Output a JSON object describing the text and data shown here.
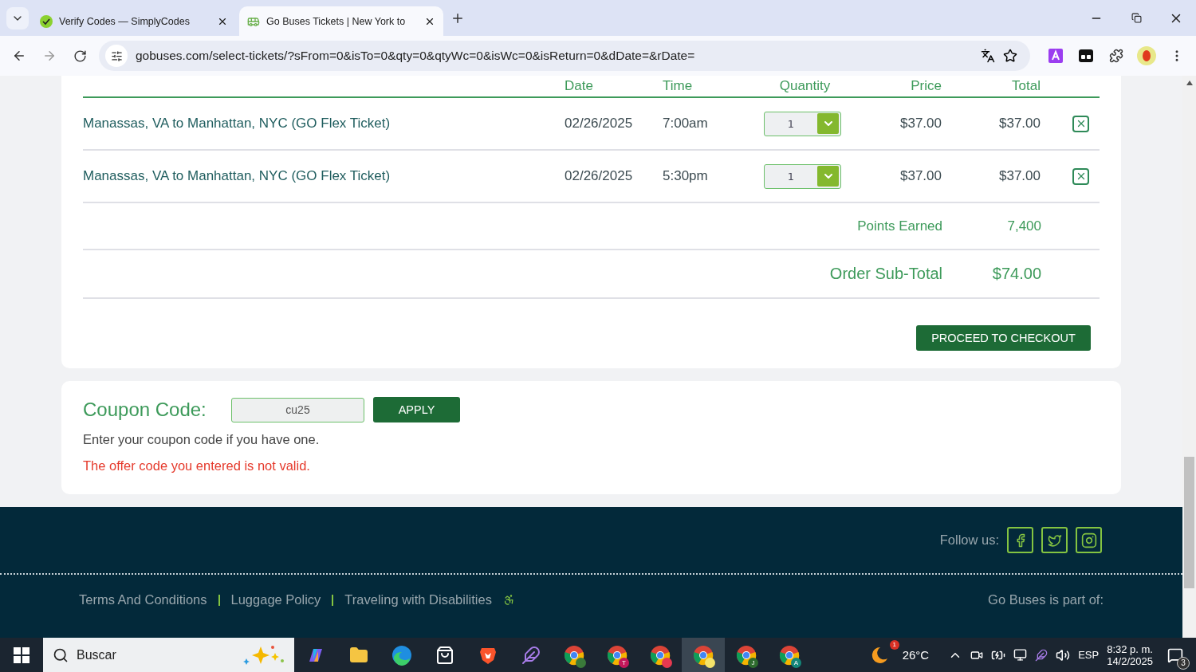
{
  "browser": {
    "tabs": [
      {
        "title": "Verify Codes — SimplyCodes",
        "selected": false
      },
      {
        "title": "Go Buses Tickets | New York to",
        "selected": true
      }
    ],
    "url": "gobuses.com/select-tickets/?sFrom=0&isTo=0&qty=0&qtyWc=0&isWc=0&isReturn=0&dDate=&rDate="
  },
  "cart": {
    "columns": [
      "Date",
      "Time",
      "Quantity",
      "Price",
      "Total"
    ],
    "items": [
      {
        "description": "Manassas, VA to Manhattan, NYC (GO Flex Ticket)",
        "date": "02/26/2025",
        "time": "7:00am",
        "quantity": "1",
        "price": "$37.00",
        "total": "$37.00"
      },
      {
        "description": "Manassas, VA to Manhattan, NYC (GO Flex Ticket)",
        "date": "02/26/2025",
        "time": "5:30pm",
        "quantity": "1",
        "price": "$37.00",
        "total": "$37.00"
      }
    ],
    "points_label": "Points Earned",
    "points": "7,400",
    "subtotal_label": "Order Sub-Total",
    "subtotal": "$74.00",
    "checkout_button": "PROCEED TO CHECKOUT"
  },
  "coupon": {
    "label": "Coupon Code:",
    "value": "cu25",
    "button": "APPLY",
    "hint": "Enter your coupon code if you have one.",
    "error": "The offer code you entered is not valid."
  },
  "footer": {
    "follow_label": "Follow us:",
    "links": [
      "Terms And Conditions",
      "Luggage Policy",
      "Traveling with Disabilities"
    ],
    "part_of": "Go Buses is part of:"
  },
  "taskbar": {
    "search": "Buscar",
    "profiles": [
      {
        "color": "#3a7a3a",
        "selected": false
      },
      {
        "badge": "T",
        "color": "#c2185b",
        "selected": false
      },
      {
        "color": "#e53950",
        "selected": false
      },
      {
        "color": "#f5e36a",
        "selected": true
      },
      {
        "badge": "J",
        "color": "#2e6b2e",
        "selected": false
      },
      {
        "badge": "A",
        "color": "#14877a",
        "selected": false
      }
    ],
    "weather_badge": "1",
    "temperature": "26°C",
    "language": "ESP",
    "time": "8:32 p. m.",
    "date": "14/2/2025",
    "notifications": "3"
  }
}
